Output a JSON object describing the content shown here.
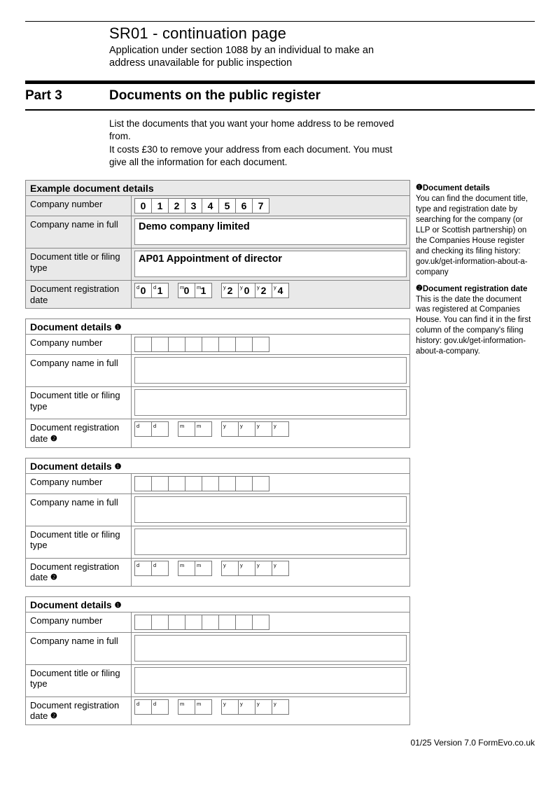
{
  "header": {
    "form_code": "SR01 - continuation page",
    "subtitle": "Application under section 1088 by an individual to make an address unavailable for public inspection"
  },
  "part": {
    "label": "Part 3",
    "title": "Documents on the public register"
  },
  "intro_lines": [
    "List the documents that you want your home address to be removed from.",
    "It costs £30 to remove your address from each document. You must give all the information for each document."
  ],
  "labels": {
    "example_heading": "Example document details",
    "details_heading": "Document details",
    "company_number": "Company number",
    "company_name": "Company name in full",
    "doc_title": "Document title or filing type",
    "reg_date": "Document registration date"
  },
  "example": {
    "company_number": [
      "0",
      "1",
      "2",
      "3",
      "4",
      "5",
      "6",
      "7"
    ],
    "company_name": "Demo company limited",
    "doc_title": "AP01 Appointment of director",
    "date": {
      "d": [
        "0",
        "1"
      ],
      "m": [
        "0",
        "1"
      ],
      "y": [
        "2",
        "0",
        "2",
        "4"
      ]
    }
  },
  "entries": [
    {
      "company_number": [
        "",
        "",
        "",
        "",
        "",
        "",
        "",
        ""
      ],
      "company_name": "",
      "doc_title": "",
      "date": {
        "d": [
          "",
          ""
        ],
        "m": [
          "",
          ""
        ],
        "y": [
          "",
          "",
          "",
          ""
        ]
      }
    },
    {
      "company_number": [
        "",
        "",
        "",
        "",
        "",
        "",
        "",
        ""
      ],
      "company_name": "",
      "doc_title": "",
      "date": {
        "d": [
          "",
          ""
        ],
        "m": [
          "",
          ""
        ],
        "y": [
          "",
          "",
          "",
          ""
        ]
      }
    },
    {
      "company_number": [
        "",
        "",
        "",
        "",
        "",
        "",
        "",
        ""
      ],
      "company_name": "",
      "doc_title": "",
      "date": {
        "d": [
          "",
          ""
        ],
        "m": [
          "",
          ""
        ],
        "y": [
          "",
          "",
          "",
          ""
        ]
      }
    }
  ],
  "notes": {
    "n1": {
      "title": "Document details",
      "body": "You can find the document title, type and registration date by searching for the company (or LLP or Scottish partnership) on the Companies House register and checking its filing history: gov.uk/get-information-about-a-company"
    },
    "n2": {
      "title": "Document registration date",
      "body": "This is the date the document was registered at Companies House. You can find it in the first column of the company's filing history: gov.uk/get-information-about-a-company."
    }
  },
  "footer": {
    "version": "01/25 Version 7.0",
    "brand": "FormEvo.co.uk"
  }
}
